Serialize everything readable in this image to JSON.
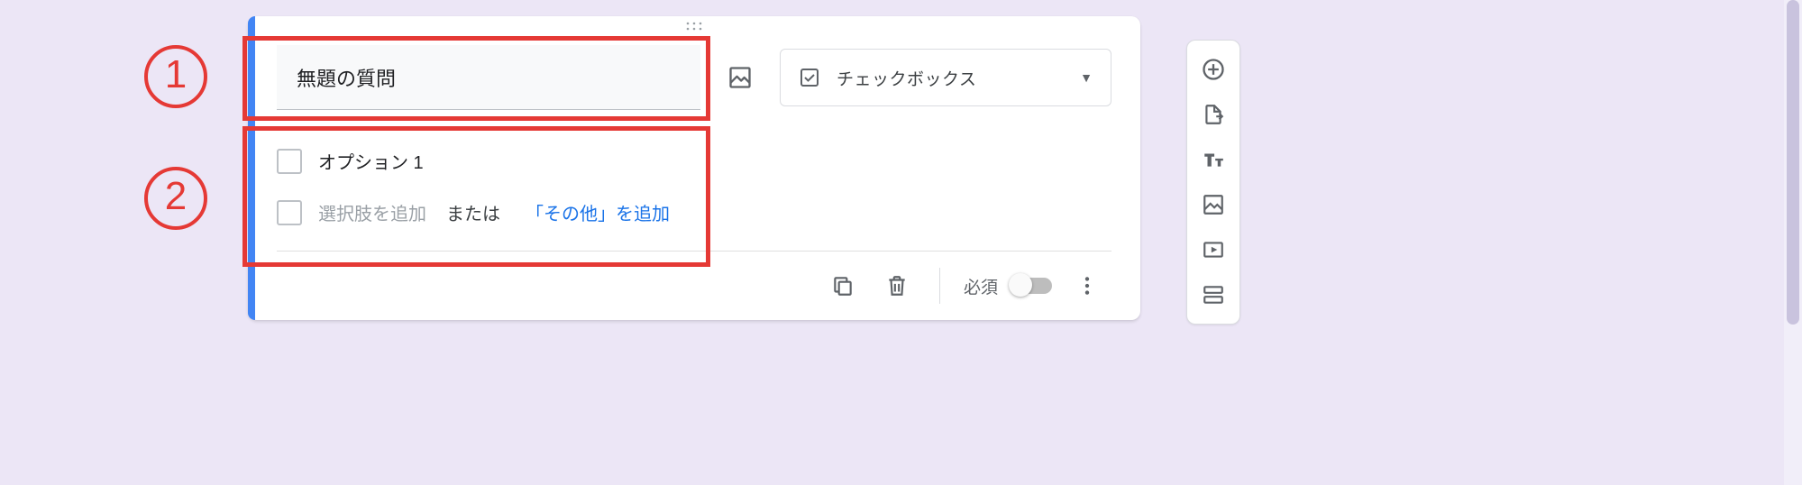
{
  "annotations": {
    "one": "1",
    "two": "2"
  },
  "question": {
    "title": "無題の質問",
    "type_label": "チェックボックス",
    "options": {
      "option1": "オプション 1",
      "add_placeholder": "選択肢を追加",
      "or_text": "または",
      "add_other_link": "「その他」を追加"
    },
    "footer": {
      "required_label": "必須"
    }
  }
}
